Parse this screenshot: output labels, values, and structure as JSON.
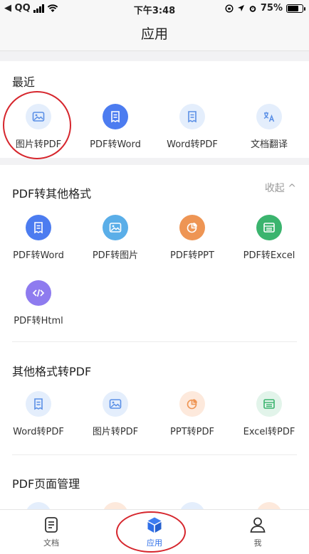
{
  "status": {
    "carrier": "◀ QQ",
    "time": "下午3:48",
    "battery": "75%"
  },
  "header": {
    "title": "应用"
  },
  "recent": {
    "title": "最近",
    "items": [
      {
        "label": "图片转PDF",
        "icon": "image-icon"
      },
      {
        "label": "PDF转Word",
        "icon": "document-icon"
      },
      {
        "label": "Word转PDF",
        "icon": "document-icon"
      },
      {
        "label": "文档翻译",
        "icon": "translate-icon"
      }
    ]
  },
  "pdf_to_other": {
    "title": "PDF转其他格式",
    "collapse_label": "收起 ^",
    "items": [
      {
        "label": "PDF转Word",
        "icon": "document-icon",
        "color": "#4c7cf0"
      },
      {
        "label": "PDF转图片",
        "icon": "image-icon",
        "color": "#5aaee8"
      },
      {
        "label": "PDF转PPT",
        "icon": "pie-chart-icon",
        "color": "#ee9554"
      },
      {
        "label": "PDF转Excel",
        "icon": "table-icon",
        "color": "#3bb46e"
      },
      {
        "label": "PDF转Html",
        "icon": "code-icon",
        "color": "#8e7bef"
      }
    ]
  },
  "other_to_pdf": {
    "title": "其他格式转PDF",
    "items": [
      {
        "label": "Word转PDF",
        "icon": "document-icon"
      },
      {
        "label": "图片转PDF",
        "icon": "image-icon"
      },
      {
        "label": "PPT转PDF",
        "icon": "pie-chart-icon"
      },
      {
        "label": "Excel转PDF",
        "icon": "table-icon"
      }
    ]
  },
  "page_manage": {
    "title": "PDF页面管理"
  },
  "tabs": [
    {
      "label": "文档",
      "icon": "document-list-icon",
      "active": false
    },
    {
      "label": "应用",
      "icon": "cube-icon",
      "active": true
    },
    {
      "label": "我",
      "icon": "person-icon",
      "active": false
    }
  ]
}
